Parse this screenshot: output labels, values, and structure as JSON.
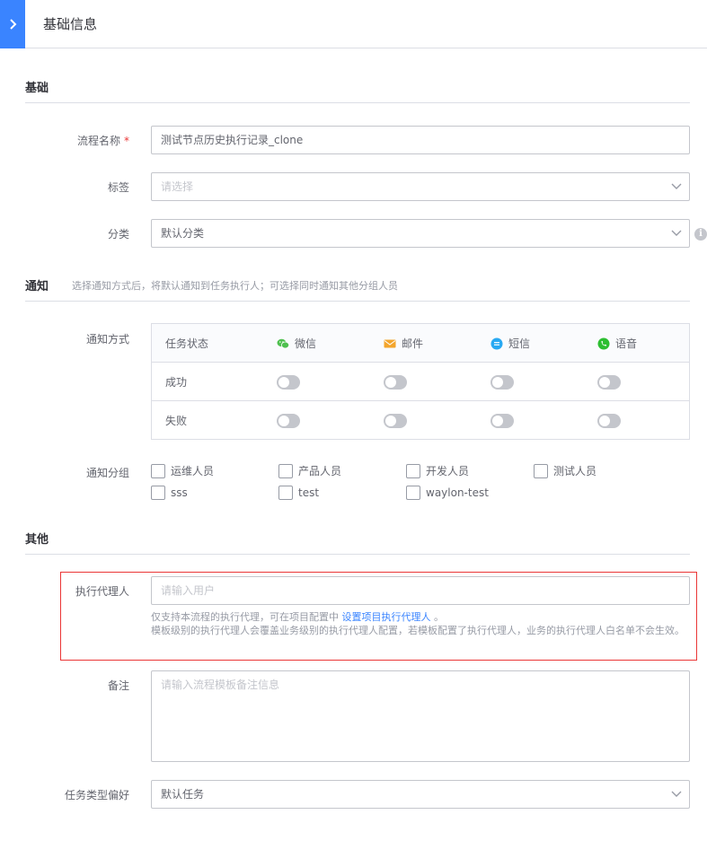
{
  "header": {
    "title": "基础信息"
  },
  "basic": {
    "section_title": "基础",
    "name_label": "流程名称",
    "name_required": "*",
    "name_value": "测试节点历史执行记录_clone",
    "tags_label": "标签",
    "tags_placeholder": "请选择",
    "category_label": "分类",
    "category_value": "默认分类"
  },
  "notify": {
    "section_title": "通知",
    "section_desc": "选择通知方式后，将默认通知到任务执行人；可选择同时通知其他分组人员",
    "method_label": "通知方式",
    "status_header": "任务状态",
    "channels": [
      {
        "label": "微信",
        "icon": "wechat-icon",
        "color": "#4fc04f"
      },
      {
        "label": "邮件",
        "icon": "mail-icon",
        "color": "#f3a52c"
      },
      {
        "label": "短信",
        "icon": "sms-icon",
        "color": "#29a9f2"
      },
      {
        "label": "语音",
        "icon": "voice-icon",
        "color": "#2dbe31"
      }
    ],
    "rows": [
      {
        "status": "成功",
        "toggles": [
          false,
          false,
          false,
          false
        ]
      },
      {
        "status": "失败",
        "toggles": [
          false,
          false,
          false,
          false
        ]
      }
    ],
    "group_label": "通知分组",
    "groups": [
      {
        "label": "运维人员",
        "checked": false
      },
      {
        "label": "产品人员",
        "checked": false
      },
      {
        "label": "开发人员",
        "checked": false
      },
      {
        "label": "测试人员",
        "checked": false
      },
      {
        "label": "sss",
        "checked": false
      },
      {
        "label": "test",
        "checked": false
      },
      {
        "label": "waylon-test",
        "checked": false
      }
    ]
  },
  "other": {
    "section_title": "其他",
    "executor_proxy_label": "执行代理人",
    "executor_proxy_placeholder": "请输入用户",
    "tip_prefix": "仅支持本流程的执行代理，可在项目配置中",
    "tip_link": "设置项目执行代理人",
    "tip_suffix": "。",
    "tip_line2": "模板级别的执行代理人会覆盖业务级别的执行代理人配置，若模板配置了执行代理人，业务的执行代理人白名单不会生效。",
    "remark_label": "备注",
    "remark_placeholder": "请输入流程模板备注信息",
    "task_type_label": "任务类型偏好",
    "task_type_value": "默认任务"
  }
}
